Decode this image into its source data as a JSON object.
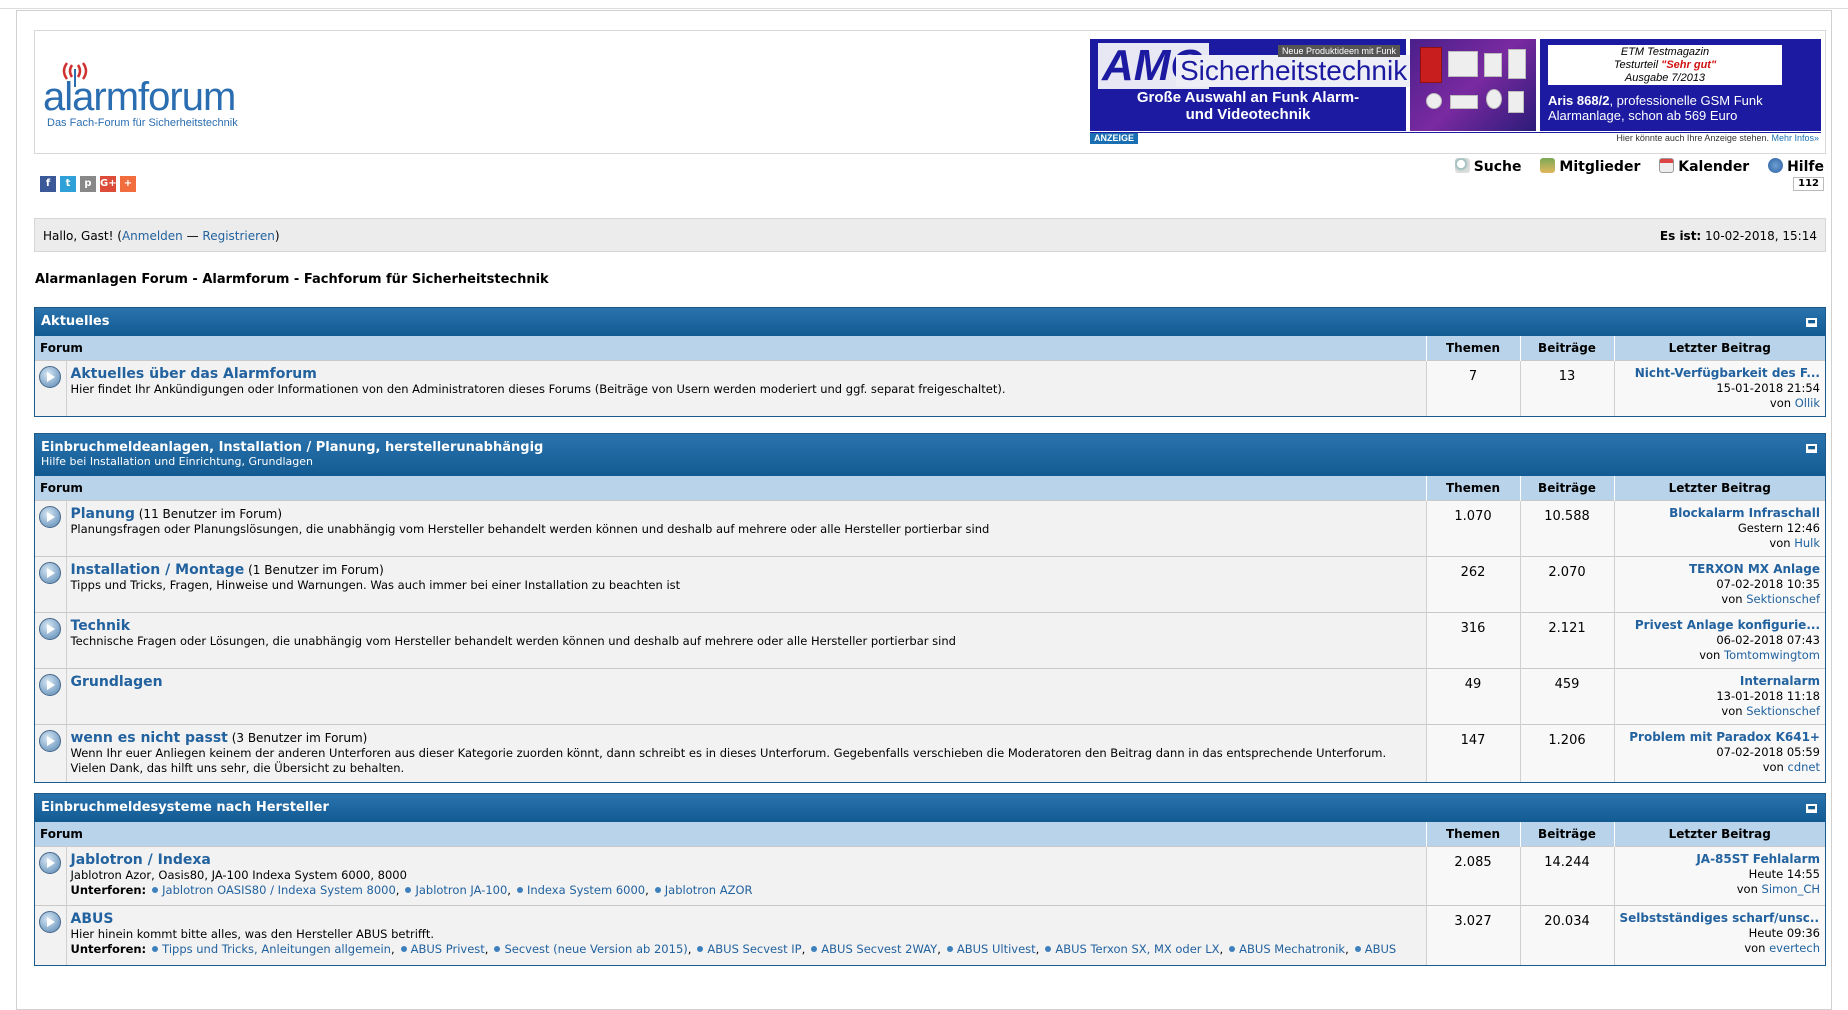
{
  "header": {
    "logo_name": "alarmforum",
    "logo_tag": "Das Fach-Forum für Sicherheitstechnik"
  },
  "ad": {
    "brand": "AMG",
    "brand_word": "Sicherheitstechnik",
    "badge": "Neue Produktideen mit Funk",
    "line1": "Große Auswahl an Funk Alarm-",
    "line2": "und Videotechnik",
    "test_line1": "ETM Testmagazin",
    "test_line2_prefix": "Testurteil ",
    "test_line2_red": "\"Sehr gut\"",
    "test_line3": "Ausgabe 7/2013",
    "product_bold": "Aris 868/2",
    "product_rest": ", professionelle GSM Funk",
    "product_line2": "Alarmanlage, schon ab 569 Euro",
    "anzeige": "ANZEIGE",
    "mehr_prefix": "Hier könnte auch Ihre Anzeige stehen. ",
    "mehr_link": "Mehr Infos»"
  },
  "social": [
    "f",
    "t",
    "p",
    "G+",
    "+"
  ],
  "nav": {
    "suche": "Suche",
    "mitglieder": "Mitglieder",
    "kalender": "Kalender",
    "hilfe": "Hilfe",
    "counter": "112"
  },
  "greeting": {
    "hallo": "Hallo, Gast! (",
    "login": "Anmelden",
    "sep": " — ",
    "register": "Registrieren",
    "close": ")",
    "time_label": "Es ist:",
    "time_value": " 10-02-2018, 15:14"
  },
  "breadcrumb": "Alarmanlagen Forum - Alarmforum - Fachforum für Sicherheitstechnik",
  "columns": {
    "forum": "Forum",
    "themen": "Themen",
    "beitraege": "Beiträge",
    "letzter": "Letzter Beitrag"
  },
  "categories": [
    {
      "title": "Aktuelles",
      "subtitle": "",
      "forums": [
        {
          "name": "Aktuelles über das Alarmforum",
          "users": "",
          "desc": "Hier findet Ihr Ankündigungen oder Informationen von den Administratoren dieses Forums (Beiträge von Usern werden moderiert und ggf. separat freigeschaltet).",
          "themen": "7",
          "beitraege": "13",
          "last_title": "Nicht-Verfügbarkeit des F...",
          "last_date": "15-01-2018 21:54",
          "last_by": "von ",
          "last_user": "Ollik"
        }
      ]
    },
    {
      "title": "Einbruchmeldeanlagen, Installation / Planung, herstellerunabhängig",
      "subtitle": "Hilfe bei Installation und Einrichtung, Grundlagen",
      "forums": [
        {
          "name": "Planung",
          "users": " (11 Benutzer im Forum)",
          "desc": "Planungsfragen oder Planungslösungen, die unabhängig vom Hersteller behandelt werden können und deshalb auf mehrere oder alle Hersteller portierbar sind",
          "themen": "1.070",
          "beitraege": "10.588",
          "last_title": "Blockalarm Infraschall",
          "last_date": "Gestern 12:46",
          "last_by": "von ",
          "last_user": "Hulk"
        },
        {
          "name": "Installation / Montage",
          "users": " (1 Benutzer im Forum)",
          "desc": "Tipps und Tricks, Fragen, Hinweise und Warnungen. Was auch immer bei einer Installation zu beachten ist",
          "themen": "262",
          "beitraege": "2.070",
          "last_title": "TERXON MX Anlage",
          "last_date": "07-02-2018 10:35",
          "last_by": "von ",
          "last_user": "Sektionschef"
        },
        {
          "name": "Technik",
          "users": "",
          "desc": "Technische Fragen oder Lösungen, die unabhängig vom Hersteller behandelt werden können und deshalb auf mehrere oder alle Hersteller portierbar sind",
          "themen": "316",
          "beitraege": "2.121",
          "last_title": "Privest Anlage konfigurie...",
          "last_date": "06-02-2018 07:43",
          "last_by": "von ",
          "last_user": "Tomtomwingtom"
        },
        {
          "name": "Grundlagen",
          "users": "",
          "desc": "",
          "themen": "49",
          "beitraege": "459",
          "last_title": "Internalarm",
          "last_date": "13-01-2018 11:18",
          "last_by": "von ",
          "last_user": "Sektionschef"
        },
        {
          "name": "wenn es nicht passt",
          "users": " (3 Benutzer im Forum)",
          "desc": "Wenn Ihr euer Anliegen keinem der anderen Unterforen aus dieser Kategorie zuorden könnt, dann schreibt es in dieses Unterforum. Gegebenfalls verschieben die Moderatoren den Beitrag dann in das entsprechende Unterforum. Vielen Dank, das hilft uns sehr, die Übersicht zu behalten.",
          "themen": "147",
          "beitraege": "1.206",
          "last_title": "Problem mit Paradox K641+",
          "last_date": "07-02-2018 05:59",
          "last_by": "von ",
          "last_user": "cdnet"
        }
      ]
    },
    {
      "title": "Einbruchmeldesysteme nach Hersteller",
      "subtitle": "",
      "forums": [
        {
          "name": "Jablotron / Indexa",
          "users": "",
          "desc": "Jablotron Azor, Oasis80, JA-100 Indexa System 6000, 8000",
          "sub_label": "Unterforen:",
          "subforums": [
            "Jablotron OASIS80 / Indexa System 8000",
            "Jablotron JA-100",
            "Indexa System 6000",
            "Jablotron AZOR"
          ],
          "themen": "2.085",
          "beitraege": "14.244",
          "last_title": "JA-85ST Fehlalarm",
          "last_date": "Heute 14:55",
          "last_by": "von ",
          "last_user": "Simon_CH"
        },
        {
          "name": "ABUS",
          "users": "",
          "desc": "Hier hinein kommt bitte alles, was den Hersteller ABUS betrifft.",
          "sub_label": "Unterforen:",
          "subforums": [
            "Tipps und Tricks, Anleitungen allgemein",
            "ABUS Privest",
            "Secvest (neue Version ab 2015)",
            "ABUS Secvest IP",
            "ABUS Secvest 2WAY",
            "ABUS Ultivest",
            "ABUS Terxon SX, MX oder LX",
            "ABUS Mechatronik",
            "ABUS"
          ],
          "themen": "3.027",
          "beitraege": "20.034",
          "last_title": "Selbstständiges scharf/unsc...",
          "last_date": "Heute 09:36",
          "last_by": "von ",
          "last_user": "evertech"
        }
      ]
    }
  ]
}
